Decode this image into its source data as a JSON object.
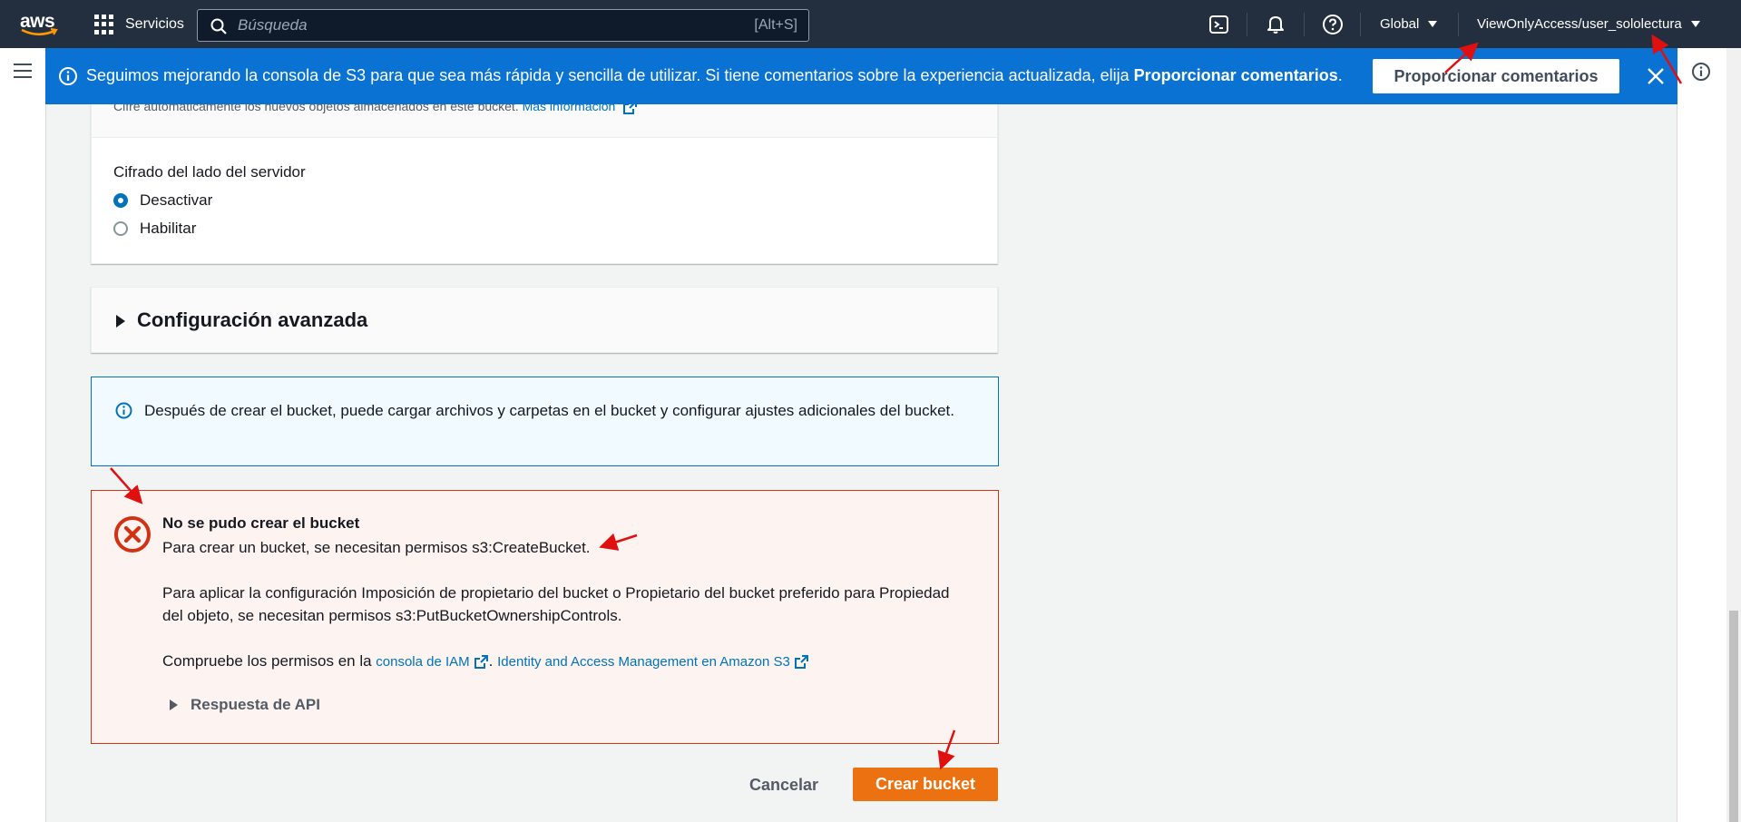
{
  "topnav": {
    "logo_text": "aws",
    "services_label": "Servicios",
    "search_placeholder": "Búsqueda",
    "search_shortcut": "[Alt+S]",
    "region_label": "Global",
    "account_label": "ViewOnlyAccess/user_sololectura"
  },
  "banner": {
    "message_prefix": "Seguimos mejorando la consola de S3 para que sea más rápida y sencilla de utilizar. Si tiene comentarios sobre la experiencia actualizada, elija ",
    "message_bold": "Proporcionar comentarios",
    "message_suffix": ".",
    "button_label": "Proporcionar comentarios",
    "color": "#0972d3"
  },
  "encryption": {
    "description": "Cifre automáticamente los nuevos objetos almacenados en este bucket.",
    "more_info_link": "Más información",
    "field_label": "Cifrado del lado del servidor",
    "options": [
      {
        "label": "Desactivar",
        "selected": true
      },
      {
        "label": "Habilitar",
        "selected": false
      }
    ]
  },
  "advanced": {
    "title": "Configuración avanzada"
  },
  "info_alert": {
    "text": "Después de crear el bucket, puede cargar archivos y carpetas en el bucket y configurar ajustes adicionales del bucket."
  },
  "error_alert": {
    "title": "No se pudo crear el bucket",
    "line1": "Para crear un bucket, se necesitan permisos s3:CreateBucket.",
    "line2": "Para aplicar la configuración Imposición de propietario del bucket o Propietario del bucket preferido para Propiedad del objeto, se necesitan permisos s3:PutBucketOwnershipControls.",
    "line3_prefix": "Compruebe los permisos en la ",
    "iam_link": "consola de IAM",
    "line3_sep": ". ",
    "iam_s3_link": "Identity and Access Management en Amazon S3",
    "api_response": "Respuesta de API",
    "color": "#d13212"
  },
  "actions": {
    "cancel_label": "Cancelar",
    "create_label": "Crear bucket",
    "create_color": "#ec7211"
  }
}
